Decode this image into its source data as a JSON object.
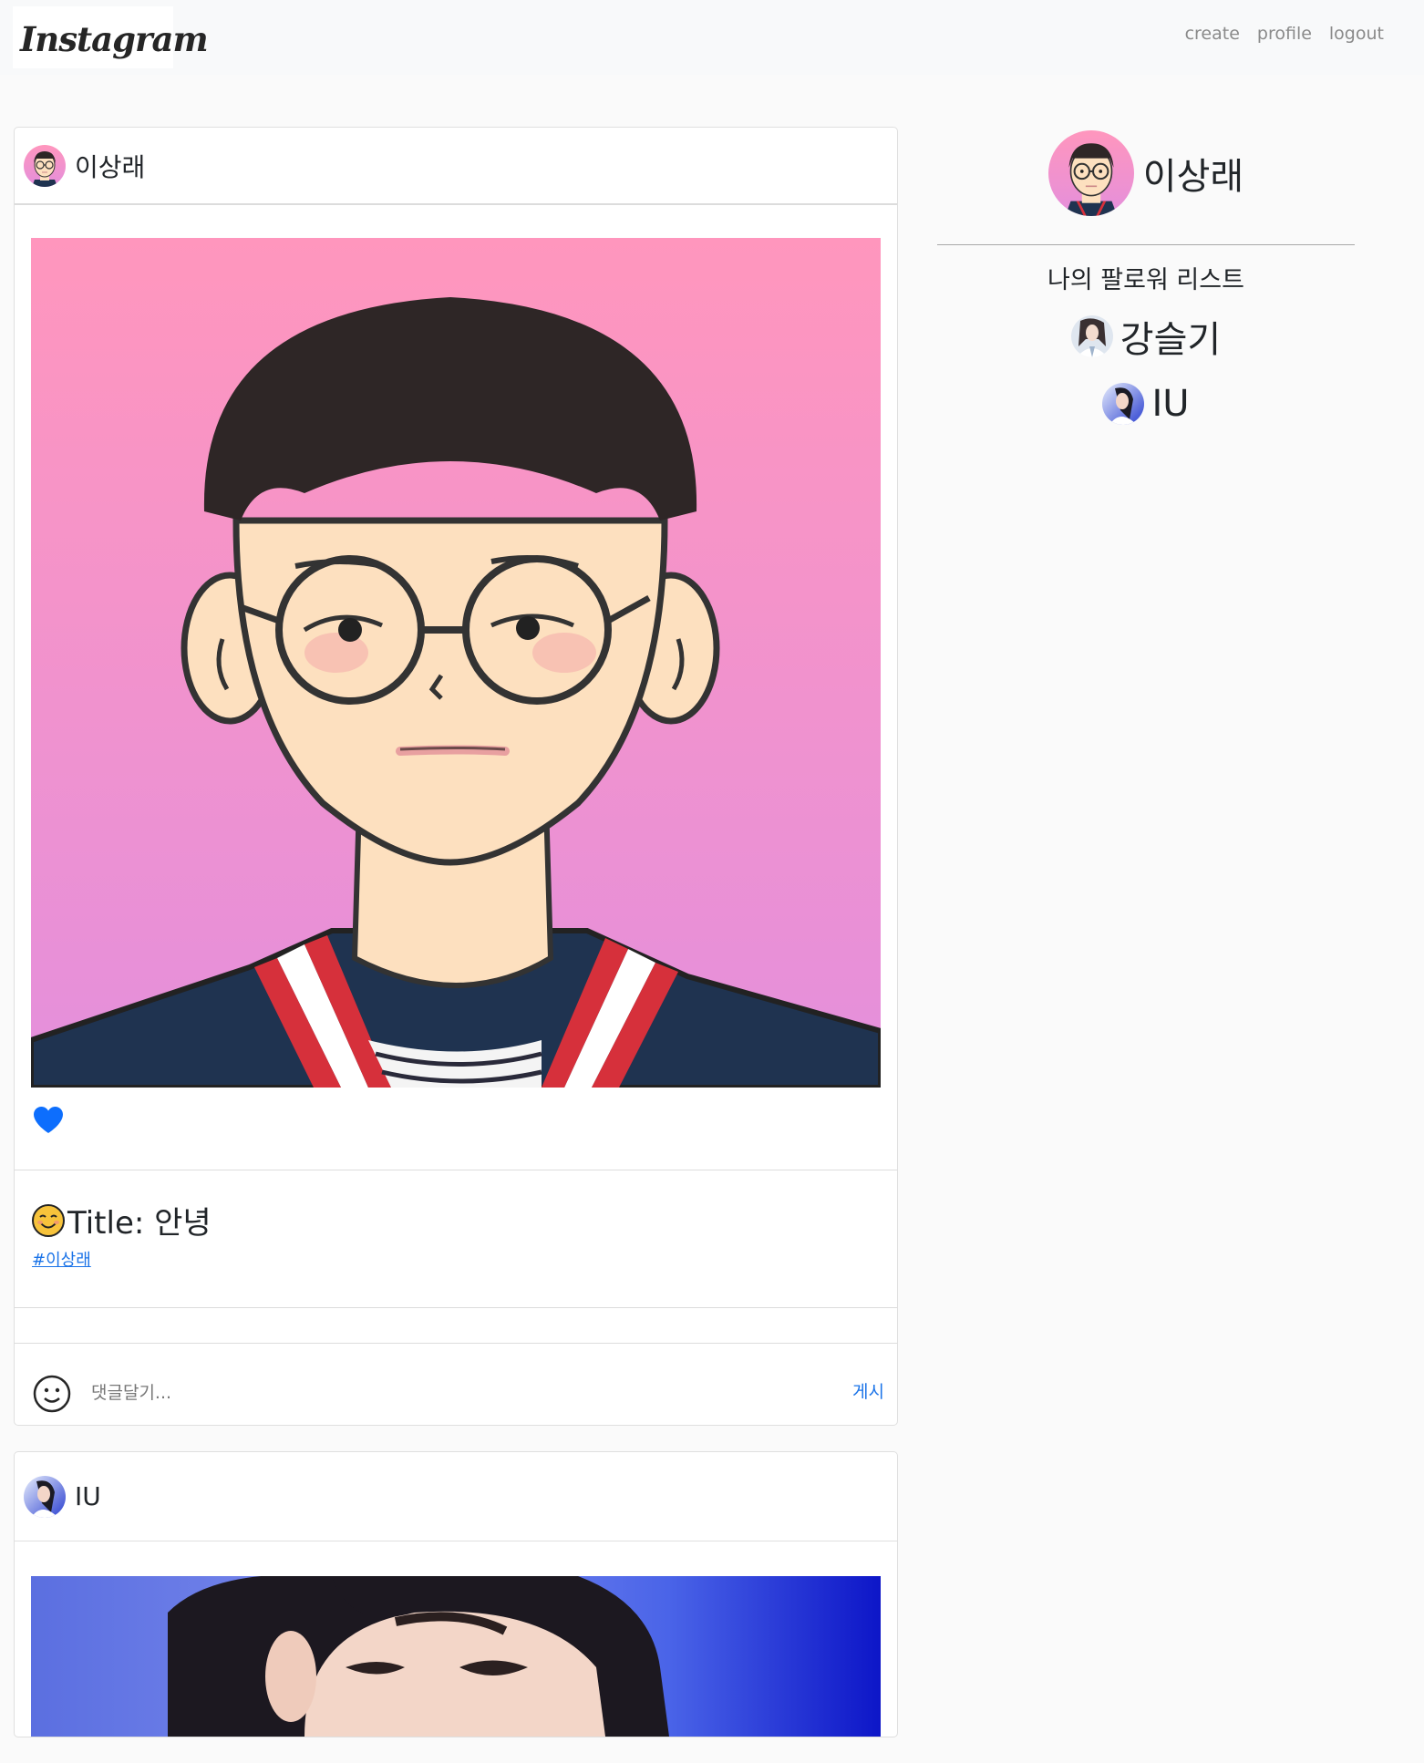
{
  "navbar": {
    "logo": "Instagram",
    "links": {
      "create": "create",
      "profile": "profile",
      "logout": "logout"
    }
  },
  "feed": {
    "posts": [
      {
        "author": "이상래",
        "avatar_icon": "cartoon-boy-avatar",
        "image": "cartoon-boy-portrait",
        "liked": true,
        "title": "Title: 안녕",
        "hashtag": "#이상래",
        "comment_placeholder": "댓글달기...",
        "post_button": "게시"
      },
      {
        "author": "IU",
        "avatar_icon": "iu-avatar",
        "image": "iu-photo"
      }
    ]
  },
  "sidebar": {
    "me": {
      "name": "이상래",
      "avatar_icon": "cartoon-boy-avatar"
    },
    "follow_title": "나의 팔로워 리스트",
    "followers": [
      {
        "name": "강슬기",
        "avatar_icon": "seulgi-avatar"
      },
      {
        "name": "IU",
        "avatar_icon": "iu-avatar"
      }
    ]
  },
  "colors": {
    "accent": "#1a73e8",
    "heart": "#0d6efd",
    "pink_top": "#ff96bd",
    "pink_bottom": "#e48fdc"
  }
}
